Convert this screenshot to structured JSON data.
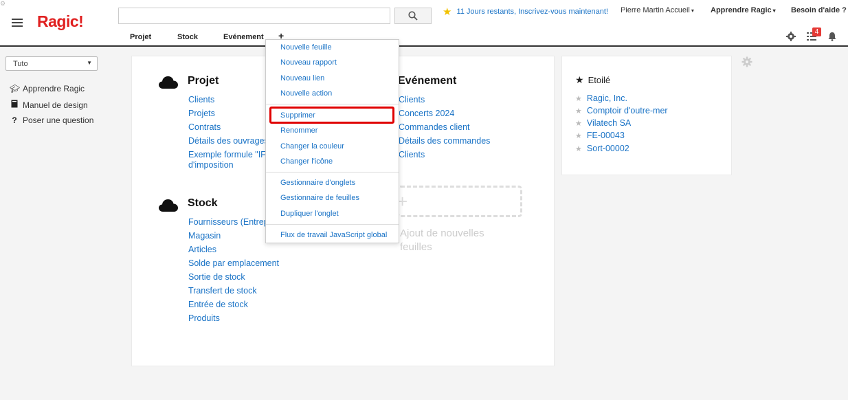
{
  "header": {
    "logo": "Ragic!",
    "search_value": "",
    "trial_text": "11 Jours restants, Inscrivez-vous maintenant!",
    "user_menu": "Pierre Martin Accueil",
    "learn_menu": "Apprendre Ragic",
    "help_menu": "Besoin d'aide ?",
    "notification_count": "4"
  },
  "nav": {
    "tabs": [
      "Projet",
      "Stock",
      "Evénement"
    ],
    "add_label": "+"
  },
  "sidebar": {
    "select_value": "Tuto",
    "items": [
      {
        "label": "Apprendre Ragic",
        "icon": "graduation-cap-icon"
      },
      {
        "label": "Manuel de design",
        "icon": "book-icon"
      },
      {
        "label": "Poser une question",
        "icon": "question-icon"
      }
    ]
  },
  "sections": {
    "projet": {
      "title": "Projet",
      "links": [
        "Clients",
        "Projets",
        "Contrats",
        "Détails des ouvrages",
        "Exemple formule \"IF\"",
        "d'imposition"
      ]
    },
    "stock": {
      "title": "Stock",
      "links": [
        "Fournisseurs (Entrepr",
        "Magasin",
        "Articles",
        "Solde par emplacement",
        "Sortie de stock",
        "Transfert de stock",
        "Entrée de stock",
        "Produits"
      ]
    },
    "evenement": {
      "title": "Evénement",
      "links": [
        "Clients",
        "Concerts 2024",
        "Commandes client",
        "Détails des commandes",
        "Clients"
      ]
    },
    "add_sheet_label": "Ajout de nouvelles feuilles",
    "add_sheet_line1": "Ajout de nouvelles",
    "add_sheet_line2": "feuilles"
  },
  "starred": {
    "title": "Etoilé",
    "items": [
      "Ragic, Inc.",
      "Comptoir d'outre-mer",
      "Vilatech SA",
      "FE-00043",
      "Sort-00002"
    ]
  },
  "dropdown": {
    "group1": [
      "Nouvelle feuille",
      "Nouveau rapport",
      "Nouveau lien",
      "Nouvelle action"
    ],
    "group2": [
      "Supprimer",
      "Renommer",
      "Changer la couleur",
      "Changer l'icône"
    ],
    "group3": [
      "Gestionnaire d'onglets",
      "Gestionnaire de feuilles",
      "Dupliquer l'onglet"
    ],
    "group4": [
      "Flux de travail JavaScript global"
    ],
    "highlighted": "Supprimer"
  },
  "colors": {
    "brand": "#e02020",
    "link": "#1a73c6",
    "highlight": "#e00000",
    "badge": "#e53935"
  }
}
